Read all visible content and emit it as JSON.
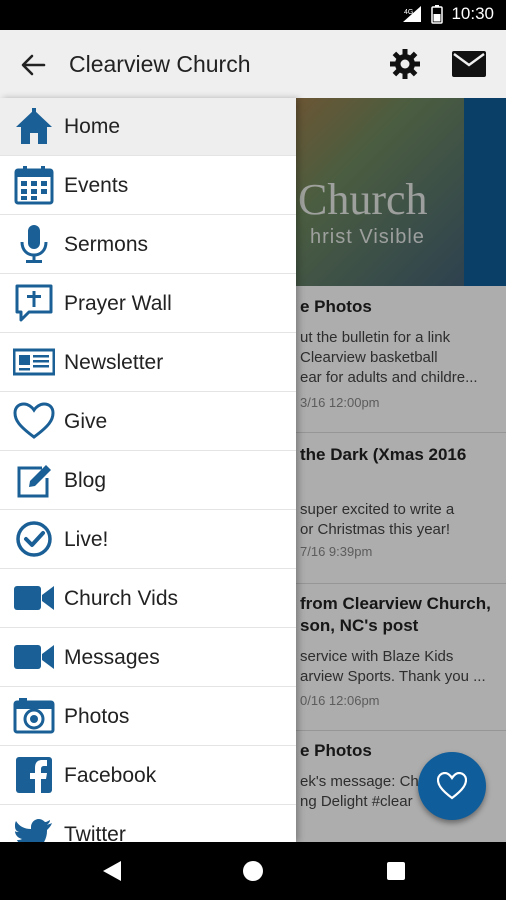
{
  "status_bar": {
    "time": "10:30"
  },
  "app_bar": {
    "title": "Clearview Church"
  },
  "hero": {
    "title": "Church",
    "subtitle": "hrist Visible"
  },
  "feed": [
    {
      "title": "e Photos",
      "lines": [
        "ut the bulletin for a link",
        "Clearview basketball",
        "ear for adults and childre..."
      ],
      "time": "3/16 12:00pm"
    },
    {
      "title": "the Dark (Xmas 2016",
      "lines": [
        "super excited to write a",
        "or Christmas this year!"
      ],
      "time": "7/16 9:39pm"
    },
    {
      "title": "from Clearview Church,",
      "title2": "son, NC's post",
      "lines": [
        "service with Blaze Kids",
        "arview Sports. Thank you ..."
      ],
      "time": "0/16 12:06pm"
    },
    {
      "title": "e Photos",
      "lines": [
        "ek's message: Ch",
        "ng Delight #clear"
      ],
      "time": ""
    }
  ],
  "menu": [
    {
      "label": "Home",
      "icon": "home-icon",
      "active": true
    },
    {
      "label": "Events",
      "icon": "calendar-icon"
    },
    {
      "label": "Sermons",
      "icon": "microphone-icon"
    },
    {
      "label": "Prayer Wall",
      "icon": "prayer-bubble-icon"
    },
    {
      "label": "Newsletter",
      "icon": "newspaper-icon"
    },
    {
      "label": "Give",
      "icon": "heart-icon"
    },
    {
      "label": "Blog",
      "icon": "edit-icon"
    },
    {
      "label": "Live!",
      "icon": "check-circle-icon"
    },
    {
      "label": "Church Vids",
      "icon": "video-camera-icon"
    },
    {
      "label": "Messages",
      "icon": "video-camera-icon"
    },
    {
      "label": "Photos",
      "icon": "camera-icon"
    },
    {
      "label": "Facebook",
      "icon": "facebook-icon"
    },
    {
      "label": "Twitter",
      "icon": "twitter-icon"
    }
  ],
  "colors": {
    "accent": "#0f5d9a",
    "app_bar": "#efefef",
    "active_row": "#eeeeee"
  }
}
